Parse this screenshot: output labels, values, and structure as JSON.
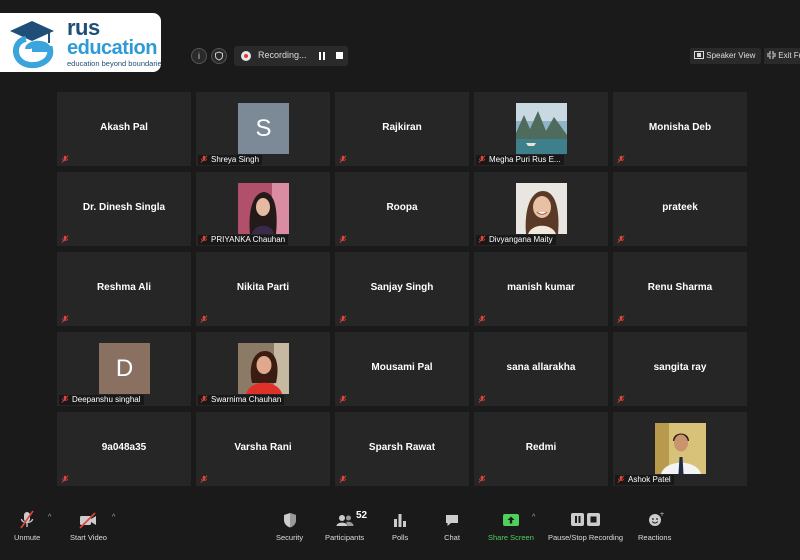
{
  "logo": {
    "brand_line1": "rus",
    "brand_line2": "education",
    "tagline": "education beyond boundaries"
  },
  "topbar": {
    "recording_label": "Recording...",
    "speaker_view_label": "Speaker View",
    "exit_fullscreen_label": "Exit Full Screen"
  },
  "participants": [
    {
      "name": "Akash Pal",
      "display": "name"
    },
    {
      "name": "Shreya Singh",
      "display": "avatar",
      "initial": "S",
      "avatar_color": "#7b8a96"
    },
    {
      "name": "Rajkiran",
      "display": "name"
    },
    {
      "name": "Megha Puri Rus E...",
      "display": "photo",
      "photo": "landscape"
    },
    {
      "name": "Monisha Deb",
      "display": "name"
    },
    {
      "name": "Dr. Dinesh Singla",
      "display": "name"
    },
    {
      "name": "PRIYANKA Chauhan",
      "display": "photo",
      "photo": "portrait-dark-hair"
    },
    {
      "name": "Roopa",
      "display": "name"
    },
    {
      "name": "Divyangana Maity",
      "display": "photo",
      "photo": "portrait-smiling"
    },
    {
      "name": "prateek",
      "display": "name"
    },
    {
      "name": "Reshma Ali",
      "display": "name"
    },
    {
      "name": "Nikita Parti",
      "display": "name"
    },
    {
      "name": "Sanjay Singh",
      "display": "name"
    },
    {
      "name": "manish kumar",
      "display": "name"
    },
    {
      "name": "Renu Sharma",
      "display": "name"
    },
    {
      "name": "Deepanshu singhal",
      "display": "avatar",
      "initial": "D",
      "avatar_color": "#8a7060"
    },
    {
      "name": "Swarnima Chauhan",
      "display": "photo",
      "photo": "portrait-red-top"
    },
    {
      "name": "Mousami Pal",
      "display": "name"
    },
    {
      "name": "sana allarakha",
      "display": "name"
    },
    {
      "name": "sangita ray",
      "display": "name"
    },
    {
      "name": "9a048a35",
      "display": "name"
    },
    {
      "name": "Varsha Rani",
      "display": "name"
    },
    {
      "name": "Sparsh Rawat",
      "display": "name"
    },
    {
      "name": "Redmi",
      "display": "name"
    },
    {
      "name": "Ashok Patel",
      "display": "photo",
      "photo": "portrait-man-tie"
    }
  ],
  "toolbar": {
    "unmute": "Unmute",
    "start_video": "Start Video",
    "security": "Security",
    "participants": "Participants",
    "participants_count": "52",
    "polls": "Polls",
    "chat": "Chat",
    "share_screen": "Share Screen",
    "recording": "Pause/Stop Recording",
    "reactions": "Reactions"
  },
  "colors": {
    "share_green": "#4fcf5c",
    "muted_red": "#e0443a",
    "tile_bg": "#262626",
    "bg": "#1a1a1a"
  }
}
